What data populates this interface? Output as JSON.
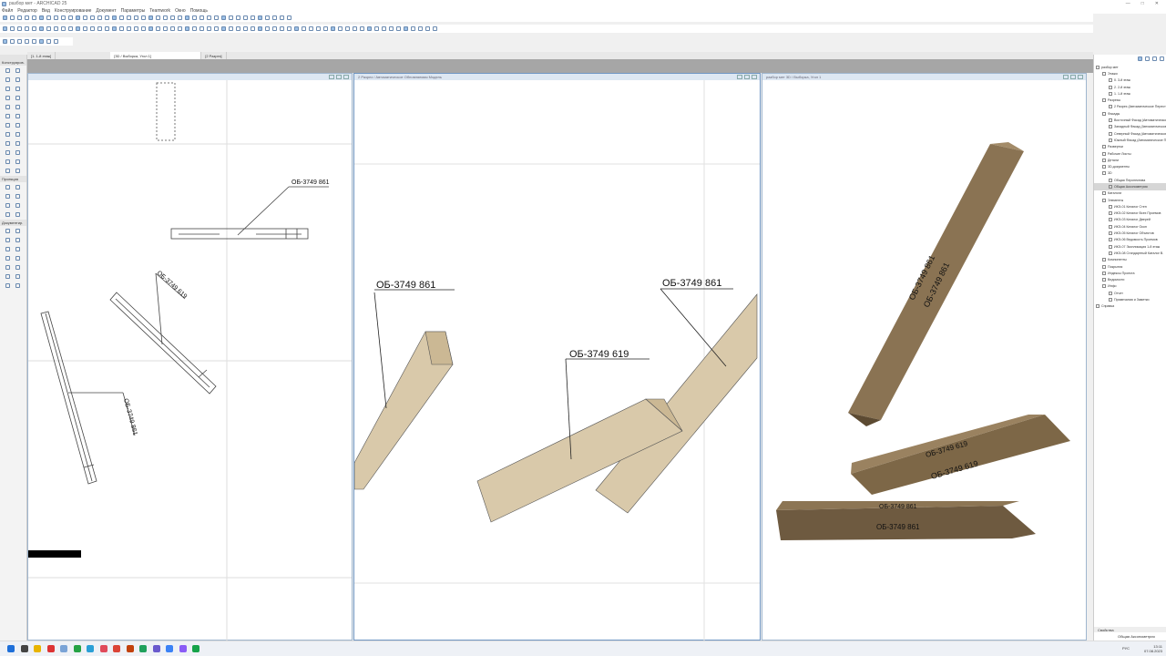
{
  "title": "разбор мет - ARCHICAD 25",
  "menu": [
    "Файл",
    "Редактор",
    "Вид",
    "Конструирование",
    "Документ",
    "Параметры",
    "Teamwork",
    "Окно",
    "Помощь"
  ],
  "tabs": [
    "[1. 1-й этаж]",
    "[3D / Выборка, Угол 1]",
    "[2 Разрез]"
  ],
  "toolbox": {
    "section1": "Конструиров.",
    "section2": "Проекция",
    "section3": "Документир."
  },
  "windows": {
    "plan": {
      "title": "",
      "labels": [
        "ОБ-3749 861",
        "ОБ-3749 619",
        "ОБ-3749 861"
      ]
    },
    "section": {
      "title": "2 Разрез / Автоматическое Обновляемая Модель",
      "labels": [
        "ОБ-3749 861",
        "ОБ-3749 619",
        "ОБ-3749 861"
      ]
    },
    "3d": {
      "title": "разбор мет 3D / Выборка, Угол 1",
      "labels": [
        "ОБ-3749 861",
        "ОБ-3749 619",
        "ОБ-3749 619",
        "ОБ-3749 861",
        "ОБ-3749 861"
      ]
    }
  },
  "navigator": {
    "items": [
      {
        "t": "разбор мет",
        "l": 0
      },
      {
        "t": "Этажи",
        "l": 1
      },
      {
        "t": "0. 3-й этаж",
        "l": 2
      },
      {
        "t": "2. 2-й этаж",
        "l": 2
      },
      {
        "t": "1. 1-й этаж",
        "l": 2
      },
      {
        "t": "Разрезы",
        "l": 1
      },
      {
        "t": "2 Разрез (Автоматическое Перестр.)",
        "l": 2
      },
      {
        "t": "Фасады",
        "l": 1
      },
      {
        "t": "Восточный Фасад (Автоматическое)",
        "l": 2
      },
      {
        "t": "Западный Фасад (Автоматическое)",
        "l": 2
      },
      {
        "t": "Северный Фасад (Автоматическое)",
        "l": 2
      },
      {
        "t": "Южный Фасад (Автоматическое П.)",
        "l": 2
      },
      {
        "t": "Развертки",
        "l": 1
      },
      {
        "t": "Рабочие Листы",
        "l": 1
      },
      {
        "t": "Детали",
        "l": 1
      },
      {
        "t": "3D-документы",
        "l": 1
      },
      {
        "t": "3D",
        "l": 1
      },
      {
        "t": "Общая Перспектива",
        "l": 2
      },
      {
        "t": "Общая Аксонометрия",
        "l": 2,
        "sel": true
      },
      {
        "t": "Каталоги",
        "l": 1
      },
      {
        "t": "Элементы",
        "l": 1
      },
      {
        "t": "ИКЭ-01 Каталог Стен",
        "l": 2
      },
      {
        "t": "ИКЭ-02 Каталог Всех Проемов",
        "l": 2
      },
      {
        "t": "ИКЭ-03 Каталог Дверей",
        "l": 2
      },
      {
        "t": "ИКЭ-04 Каталог Окон",
        "l": 2
      },
      {
        "t": "ИКЭ-05 Каталог Объектов",
        "l": 2
      },
      {
        "t": "ИКЭ-06 Ведомость Проемов",
        "l": 2
      },
      {
        "t": "ИКЭ-07 Экспликация 1-й этаж",
        "l": 2
      },
      {
        "t": "ИКЭ-08 Стандартный Каталог В.",
        "l": 2
      },
      {
        "t": "Компоненты",
        "l": 1
      },
      {
        "t": "Покрытия",
        "l": 1
      },
      {
        "t": "Индексы Проекта",
        "l": 1
      },
      {
        "t": "Ведомости",
        "l": 1
      },
      {
        "t": "Инфо",
        "l": 1
      },
      {
        "t": "Отчет",
        "l": 2
      },
      {
        "t": "Примечания и Заметки",
        "l": 2
      },
      {
        "t": "Справка",
        "l": 0
      }
    ],
    "properties_title": "Свойства",
    "properties_value": "Общая Аксонометрия"
  },
  "tray": {
    "lang": "РУС",
    "time": "13:11",
    "date": "07.08.2023"
  },
  "colors": {
    "wood_light": "#d9c9aa",
    "wood_dark": "#6e5a40",
    "accent": "#9fb6cf"
  }
}
